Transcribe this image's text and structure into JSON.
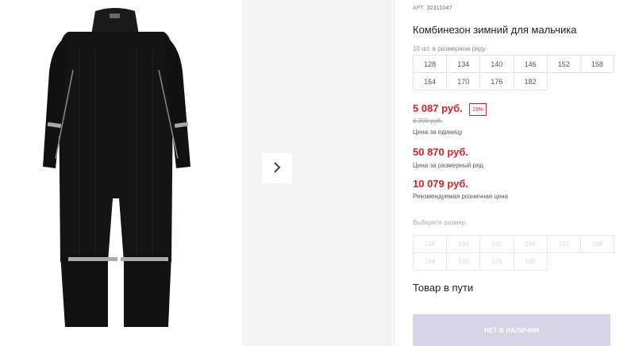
{
  "product": {
    "sku_label": "АРТ.",
    "sku": "32311047",
    "title": "Комбинезон зимний для мальчика",
    "pack_note": "10 шт. в размерном ряду",
    "sizes": [
      "128",
      "134",
      "140",
      "146",
      "152",
      "158",
      "164",
      "170",
      "176",
      "182"
    ]
  },
  "pricing": {
    "unit_price": "5 087 руб.",
    "discount": "19%",
    "old_price": "6 300 руб.",
    "unit_label": "Цена за единицу",
    "row_price": "50 870 руб.",
    "row_label": "Цена за размерный ряд",
    "rrp": "10 079 руб.",
    "rrp_label": "Рекомендуемая розничная цена"
  },
  "selection": {
    "prompt": "Выберите размер:",
    "sizes_disabled": [
      "128",
      "134",
      "140",
      "146",
      "152",
      "158",
      "164",
      "170",
      "176",
      "182"
    ]
  },
  "status": {
    "availability": "Товар в пути",
    "button_label": "НЕТ В НАЛИЧИИ"
  },
  "icons": {
    "next": "chevron-right-icon"
  },
  "colors": {
    "price_red": "#d6202f",
    "button_disabled": "#d9d3e6"
  }
}
